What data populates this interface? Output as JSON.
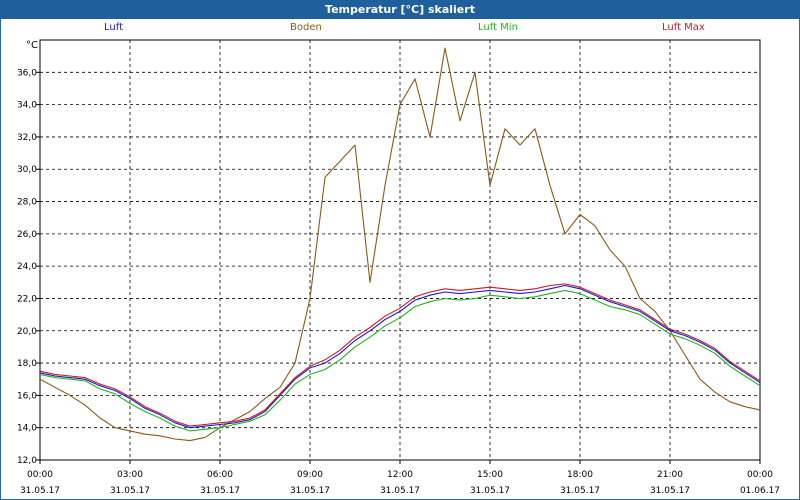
{
  "window": {
    "title": "Temperatur [°C] skaliert"
  },
  "colors": {
    "background": "#ffffff",
    "titlebar": "#1f5f9c",
    "grid": "#000000"
  },
  "chart_data": {
    "type": "line",
    "title": "Temperatur [°C] skaliert",
    "ylabel": "°C",
    "ylim": [
      12.0,
      38.0
    ],
    "yticks": [
      "12,0",
      "14,0",
      "16,0",
      "18,0",
      "20,0",
      "22,0",
      "24,0",
      "26,0",
      "28,0",
      "30,0",
      "32,0",
      "34,0",
      "36,0"
    ],
    "yticks_values": [
      12,
      14,
      16,
      18,
      20,
      22,
      24,
      26,
      28,
      30,
      32,
      34,
      36
    ],
    "xlim": [
      0,
      24
    ],
    "xticks_values": [
      0,
      3,
      6,
      9,
      12,
      15,
      18,
      21,
      24
    ],
    "xticks_time": [
      "00:00",
      "03:00",
      "06:00",
      "09:00",
      "12:00",
      "15:00",
      "18:00",
      "21:00",
      "00:00"
    ],
    "xticks_date": [
      "31.05.17",
      "31.05.17",
      "31.05.17",
      "31.05.17",
      "31.05.17",
      "31.05.17",
      "31.05.17",
      "31.05.17",
      "01.06.17"
    ],
    "grid": true,
    "legend_position": "top",
    "series": [
      {
        "name": "Luft",
        "color": "#1a1ac8",
        "x": [
          0,
          0.5,
          1,
          1.5,
          2,
          2.5,
          3,
          3.5,
          4,
          4.5,
          5,
          5.5,
          6,
          6.5,
          7,
          7.5,
          8,
          8.5,
          9,
          9.5,
          10,
          10.5,
          11,
          11.5,
          12,
          12.5,
          13,
          13.5,
          14,
          14.5,
          15,
          15.5,
          16,
          16.5,
          17,
          17.5,
          18,
          18.5,
          19,
          19.5,
          20,
          20.5,
          21,
          21.5,
          22,
          22.5,
          23,
          23.5,
          24
        ],
        "y": [
          17.4,
          17.2,
          17.1,
          17.0,
          16.6,
          16.3,
          15.8,
          15.2,
          14.8,
          14.3,
          14.0,
          14.1,
          14.2,
          14.3,
          14.5,
          15.0,
          16.0,
          17.0,
          17.7,
          18.0,
          18.6,
          19.4,
          20.0,
          20.7,
          21.2,
          21.9,
          22.2,
          22.4,
          22.3,
          22.4,
          22.5,
          22.4,
          22.3,
          22.4,
          22.6,
          22.8,
          22.6,
          22.2,
          21.8,
          21.5,
          21.2,
          20.6,
          20.0,
          19.7,
          19.3,
          18.8,
          18.0,
          17.4,
          16.8
        ]
      },
      {
        "name": "Boden",
        "color": "#8b5a14",
        "x": [
          0,
          0.5,
          1,
          1.5,
          2,
          2.5,
          3,
          3.5,
          4,
          4.5,
          5,
          5.5,
          6,
          6.5,
          7,
          7.5,
          8,
          8.5,
          9,
          9.5,
          10,
          10.5,
          11,
          11.5,
          12,
          12.5,
          13,
          13.5,
          14,
          14.5,
          15,
          15.5,
          16,
          16.5,
          17,
          17.5,
          18,
          18.5,
          19,
          19.5,
          20,
          20.5,
          21,
          21.5,
          22,
          22.5,
          23,
          23.5,
          24
        ],
        "y": [
          17.0,
          16.5,
          16.0,
          15.4,
          14.6,
          14.0,
          13.8,
          13.6,
          13.5,
          13.3,
          13.2,
          13.4,
          14.0,
          14.5,
          15.0,
          15.8,
          16.5,
          18.0,
          22.0,
          29.5,
          30.5,
          31.5,
          23.0,
          29.0,
          34.0,
          35.6,
          32.0,
          37.5,
          33.0,
          36.0,
          29.0,
          32.5,
          31.5,
          32.5,
          29.0,
          26.0,
          27.2,
          26.5,
          25.0,
          24.0,
          22.0,
          21.2,
          20.0,
          18.5,
          17.0,
          16.2,
          15.6,
          15.3,
          15.1
        ]
      },
      {
        "name": "Luft Min",
        "color": "#22b422",
        "x": [
          0,
          0.5,
          1,
          1.5,
          2,
          2.5,
          3,
          3.5,
          4,
          4.5,
          5,
          5.5,
          6,
          6.5,
          7,
          7.5,
          8,
          8.5,
          9,
          9.5,
          10,
          10.5,
          11,
          11.5,
          12,
          12.5,
          13,
          13.5,
          14,
          14.5,
          15,
          15.5,
          16,
          16.5,
          17,
          17.5,
          18,
          18.5,
          19,
          19.5,
          20,
          20.5,
          21,
          21.5,
          22,
          22.5,
          23,
          23.5,
          24
        ],
        "y": [
          17.3,
          17.1,
          17.0,
          16.9,
          16.4,
          16.1,
          15.5,
          15.0,
          14.6,
          14.1,
          13.8,
          13.9,
          14.0,
          14.2,
          14.4,
          14.8,
          15.7,
          16.7,
          17.3,
          17.6,
          18.2,
          19.0,
          19.6,
          20.3,
          20.8,
          21.5,
          21.8,
          22.0,
          21.9,
          22.0,
          22.2,
          22.1,
          22.0,
          22.1,
          22.3,
          22.5,
          22.3,
          21.9,
          21.5,
          21.3,
          21.0,
          20.4,
          19.8,
          19.5,
          19.1,
          18.6,
          17.8,
          17.2,
          16.6
        ]
      },
      {
        "name": "Luft Max",
        "color": "#c81a2a",
        "x": [
          0,
          0.5,
          1,
          1.5,
          2,
          2.5,
          3,
          3.5,
          4,
          4.5,
          5,
          5.5,
          6,
          6.5,
          7,
          7.5,
          8,
          8.5,
          9,
          9.5,
          10,
          10.5,
          11,
          11.5,
          12,
          12.5,
          13,
          13.5,
          14,
          14.5,
          15,
          15.5,
          16,
          16.5,
          17,
          17.5,
          18,
          18.5,
          19,
          19.5,
          20,
          20.5,
          21,
          21.5,
          22,
          22.5,
          23,
          23.5,
          24
        ],
        "y": [
          17.5,
          17.3,
          17.2,
          17.1,
          16.7,
          16.4,
          15.9,
          15.3,
          14.9,
          14.4,
          14.1,
          14.2,
          14.3,
          14.4,
          14.6,
          15.1,
          16.1,
          17.1,
          17.8,
          18.2,
          18.8,
          19.6,
          20.2,
          20.9,
          21.4,
          22.1,
          22.4,
          22.6,
          22.5,
          22.6,
          22.7,
          22.6,
          22.5,
          22.6,
          22.8,
          22.9,
          22.7,
          22.3,
          21.9,
          21.6,
          21.3,
          20.7,
          20.1,
          19.8,
          19.4,
          18.9,
          18.1,
          17.5,
          16.9
        ]
      }
    ]
  }
}
